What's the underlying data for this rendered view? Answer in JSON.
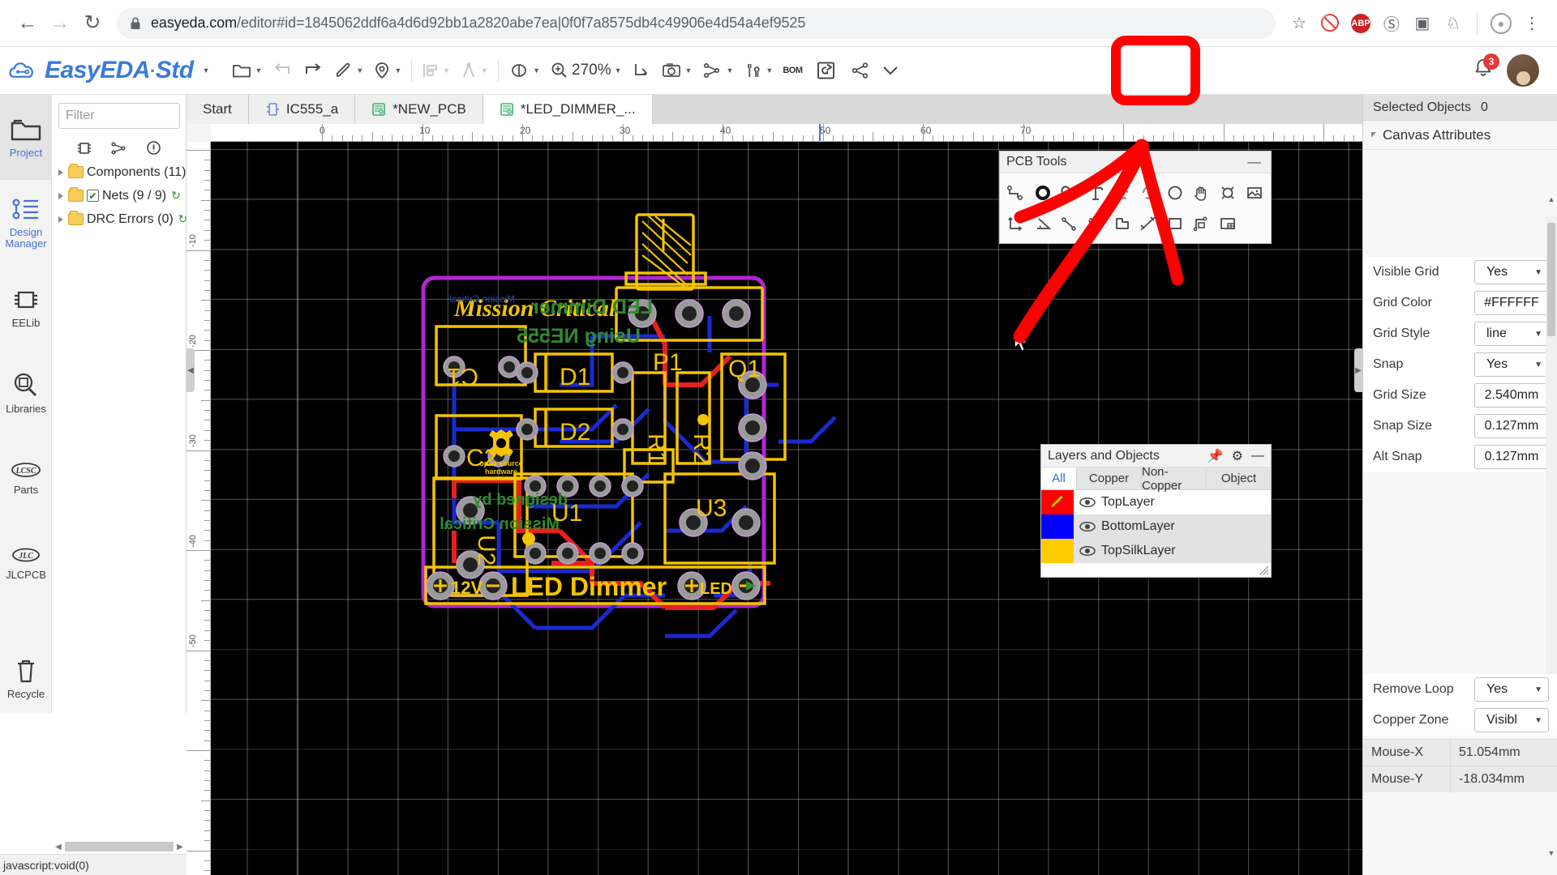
{
  "browser": {
    "back_icon": "back-arrow-icon",
    "forward_icon": "forward-arrow-icon",
    "reload_icon": "reload-icon",
    "lock_icon": "lock-icon",
    "url_domain": "easyeda.com",
    "url_path": "/editor#id=1845062ddf6a4d6d92bb1a2820abe7ea|0f0f7a8575db4c49906e4d54a4ef9525",
    "url_full": "easyeda.com/editor#id=1845062ddf6a4d6d92bb1a2820abe7ea|0f0f7a8575db4c49906e4d54a4ef9525",
    "star_icon": "bookmark-star-icon",
    "block_icon": "block-icon",
    "abp_label": "ABP",
    "abp_color": "#cc2222",
    "menu_icon": "kebab-menu-icon"
  },
  "app": {
    "brand_name": "EasyEDA",
    "brand_sep": "·",
    "brand_edition": "Std",
    "toolbar": {
      "file_label": "file-icon",
      "undo_label": "undo-icon",
      "redo_label": "redo-icon",
      "pen_label": "pen-icon",
      "place_label": "location-pin-icon",
      "align_label": "align-icon",
      "measure_label": "compass-icon",
      "view_label": "view-eye-icon",
      "zoom_label": "270%",
      "import_label": "import-icon",
      "photo_label": "camera-icon",
      "route_label": "route-icon",
      "tools_label": "tools-icon",
      "bom_label": "BOM",
      "generate_label": "generate-gerber-icon",
      "share_label": "share-icon",
      "more_label": "chevron-down-icon",
      "notifications_count": "3",
      "notifications_color": "#e53935"
    }
  },
  "rail": {
    "items": [
      {
        "label": "Project",
        "icon": "folder-icon",
        "active": true
      },
      {
        "label": "Design\nManager",
        "icon": "design-manager-icon",
        "active": false
      },
      {
        "label": "EELib",
        "icon": "chip-icon",
        "active": false
      },
      {
        "label": "Libraries",
        "icon": "library-search-icon",
        "active": false
      },
      {
        "label": "Parts",
        "icon": "lcsc-icon",
        "active": false
      },
      {
        "label": "JLCPCB",
        "icon": "jlcpcb-icon",
        "active": false
      }
    ],
    "recycle": {
      "label": "Recycle",
      "icon": "trash-icon"
    }
  },
  "left_panel": {
    "filter_placeholder": "Filter",
    "filter_value": "",
    "tool_icons": [
      "chip-outline-icon",
      "nets-icon",
      "warning-circle-icon"
    ],
    "tree": [
      {
        "label": "Components (11)",
        "checkbox": false,
        "refresh": true
      },
      {
        "label": "Nets (9 / 9)",
        "checkbox": true,
        "refresh": true
      },
      {
        "label": "DRC Errors (0)",
        "checkbox": false,
        "refresh": true
      }
    ]
  },
  "status_bar": {
    "link_text": "javascript:void(0)"
  },
  "tabs": [
    {
      "label": "Start",
      "icon": null,
      "active": false
    },
    {
      "label": "IC555_a",
      "icon": "schematic-icon",
      "active": false
    },
    {
      "label": "*NEW_PCB",
      "icon": "pcb-icon",
      "active": false
    },
    {
      "label": "*LED_DIMMER_...",
      "icon": "pcb-icon",
      "active": true
    }
  ],
  "canvas": {
    "ruler_h_labels": [
      "0",
      "10",
      "20",
      "30",
      "40",
      "50",
      "60",
      "70"
    ],
    "ruler_v_labels": [
      "-10",
      "-20",
      "-30",
      "-40",
      "-50"
    ],
    "background": "#000000",
    "grid_color": "#FFFFFF",
    "silk_text": {
      "title_front": "Mission Critical",
      "title_back": "LED Dimmer",
      "subtitle_back": "Using NE555",
      "designer_line1": "designed by",
      "designer_line2": "Mission Critical",
      "osh_text": "open source hardware",
      "board_label": "LED Dimmer",
      "power_label": "12V",
      "led_label": "LED"
    },
    "designators": [
      "C1",
      "C2",
      "D1",
      "D2",
      "R1",
      "R2",
      "Q1",
      "U1",
      "U2",
      "U3",
      "P1"
    ],
    "colors": {
      "top_layer": "#FF0000",
      "bottom_layer": "#0000FF",
      "top_silk": "#FFCC00",
      "bottom_silk": "#228B22",
      "board_outline": "#A020C0",
      "pad": "#9a9a9a"
    }
  },
  "properties": {
    "header_label": "Selected Objects",
    "header_count": "0",
    "section_title": "Canvas Attributes",
    "rows": [
      {
        "label": "Visible Grid",
        "value": "Yes",
        "type": "select"
      },
      {
        "label": "Grid Color",
        "value": "#FFFFFF",
        "type": "text"
      },
      {
        "label": "Grid Style",
        "value": "line",
        "type": "select"
      },
      {
        "label": "Snap",
        "value": "Yes",
        "type": "select"
      },
      {
        "label": "Grid Size",
        "value": "2.540mm",
        "type": "text"
      },
      {
        "label": "Snap Size",
        "value": "0.127mm",
        "type": "text"
      },
      {
        "label": "Alt Snap",
        "value": "0.127mm",
        "type": "text"
      }
    ],
    "rows_bottom": [
      {
        "label": "Remove Loop",
        "value": "Yes",
        "type": "select"
      },
      {
        "label": "Copper Zone",
        "value": "Visibl",
        "type": "select"
      }
    ],
    "mouse": [
      {
        "key": "Mouse-X",
        "value": "51.054mm"
      },
      {
        "key": "Mouse-Y",
        "value": "-18.034mm"
      }
    ]
  },
  "pcb_tools": {
    "title": "PCB Tools",
    "minimize_icon": "minimize-icon",
    "row1": [
      "track-icon",
      "via-icon",
      "pad-icon",
      "text-icon",
      "arc-ccw-icon",
      "arc-cw-icon",
      "circle-icon",
      "hand-icon",
      "hole-icon",
      "image-icon"
    ],
    "row2": [
      "dimension-icon",
      "angle-icon",
      "line-icon",
      "select-region-icon",
      "copper-area-icon",
      "measure-icon",
      "rect-icon",
      "panelize-icon",
      "layout-icon"
    ]
  },
  "layers_panel": {
    "title": "Layers and Objects",
    "pin_icon": "pin-icon",
    "gear_icon": "gear-icon",
    "minimize_icon": "minimize-icon",
    "tabs": [
      {
        "label": "All",
        "active": true
      },
      {
        "label": "Copper",
        "active": false
      },
      {
        "label": "Non-Copper",
        "active": false
      },
      {
        "label": "Object",
        "active": false
      }
    ],
    "layers": [
      {
        "name": "TopLayer",
        "color": "#FF0000",
        "visible": true,
        "active": true
      },
      {
        "name": "BottomLayer",
        "color": "#0000FF",
        "visible": true,
        "active": false
      },
      {
        "name": "TopSilkLayer",
        "color": "#FFCC00",
        "visible": true,
        "active": false
      }
    ]
  },
  "annotation": {
    "highlight_color": "#FF0000",
    "highlight_target": "generate-gerber-icon",
    "arrow_description": "red-arrow-pointing-to-generate-button"
  }
}
